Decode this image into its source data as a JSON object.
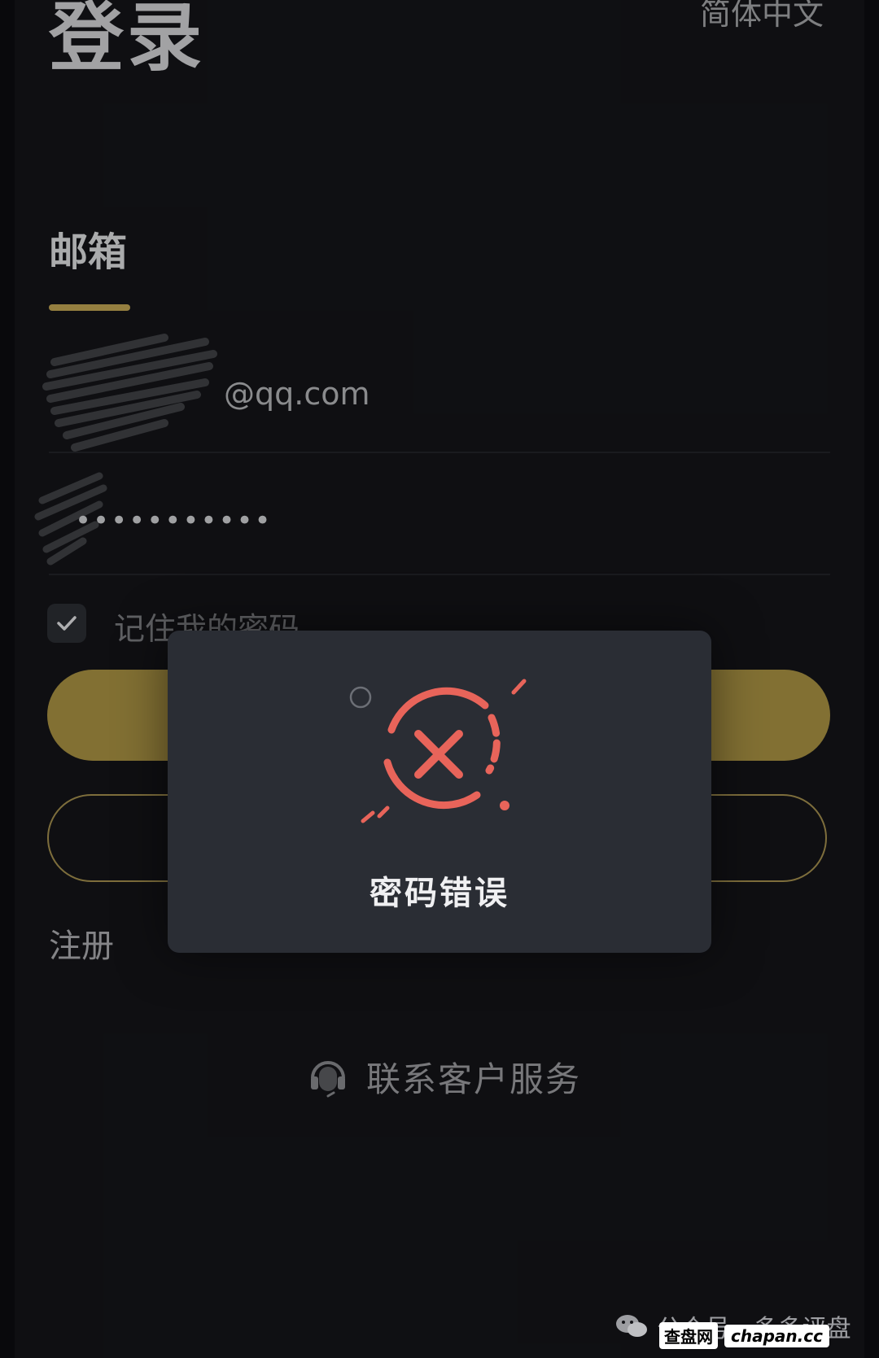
{
  "header": {
    "title": "登录",
    "language": "简体中文"
  },
  "form": {
    "tab_label": "邮箱",
    "email_suffix": "@qq.com",
    "password_masked": "•••••••••••",
    "remember_label": "记住我的密码",
    "remember_checked": true
  },
  "links": {
    "register": "注册",
    "support": "联系客户服务"
  },
  "dialog": {
    "message": "密码错误"
  },
  "watermark": {
    "text": "公众号 · 多多评盘",
    "site_badge": "查盘网",
    "site_url": "chapan.cc"
  },
  "colors": {
    "accent": "#c7aa56",
    "error": "#e8645a",
    "background": "#141519"
  }
}
